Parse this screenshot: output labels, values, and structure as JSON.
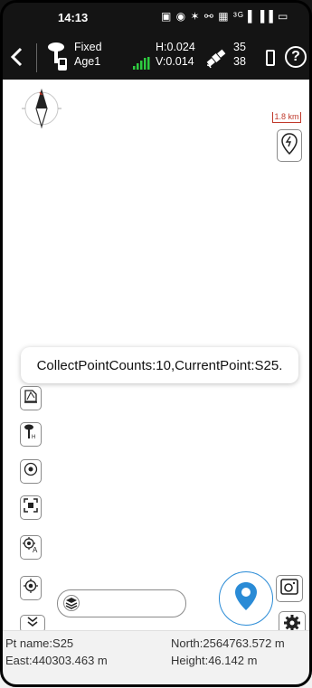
{
  "status_bar": {
    "time": "14:13",
    "system_icons": "▣ ◉ ✶ ⚯ ▦ ³ᴳ▐ ▐▐ ▭"
  },
  "toolbar": {
    "fix_status": "Fixed",
    "age": "Age1",
    "h_precision": "H:0.024",
    "v_precision": "V:0.014",
    "sats_used": "35",
    "sats_visible": "38",
    "help_label": "?"
  },
  "map": {
    "scale_label": "1.8 km"
  },
  "toast": {
    "message": "CollectPointCounts:10,CurrentPoint:S25."
  },
  "info_panel": {
    "pt_name": "Pt name:S25",
    "north": "North:2564763.572 m",
    "east": "East:440303.463 m",
    "height": "Height:46.142 m"
  },
  "colors": {
    "toolbar_bg": "#141414",
    "accent": "#2a8bd6",
    "signal": "#2ecc40",
    "scale": "#c0392b"
  },
  "icons": [
    "back-icon",
    "rover-icon",
    "signal-icon",
    "satellite-icon",
    "battery-icon",
    "help-icon",
    "compass-icon",
    "location-search-icon",
    "area-icon",
    "antenna-icon",
    "target-icon",
    "fullscreen-icon",
    "auto-locate-icon",
    "locate-icon",
    "collapse-icon",
    "layers-icon",
    "point-collect-icon",
    "map-camera-icon",
    "settings-icon"
  ]
}
